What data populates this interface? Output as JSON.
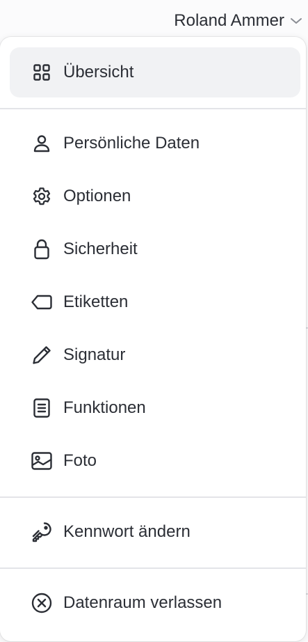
{
  "user": {
    "name": "Roland Ammer",
    "chevron_icon": "chevron-down-icon"
  },
  "menu": {
    "overview": {
      "label": "Übersicht",
      "icon": "grid-icon",
      "active": true
    },
    "items": [
      {
        "label": "Persönliche Daten",
        "icon": "user-icon"
      },
      {
        "label": "Optionen",
        "icon": "gear-icon"
      },
      {
        "label": "Sicherheit",
        "icon": "lock-icon"
      },
      {
        "label": "Etiketten",
        "icon": "tag-icon"
      },
      {
        "label": "Signatur",
        "icon": "pen-icon"
      },
      {
        "label": "Funktionen",
        "icon": "document-icon"
      },
      {
        "label": "Foto",
        "icon": "photo-icon"
      }
    ],
    "change_password": {
      "label": "Kennwort ändern",
      "icon": "key-icon"
    },
    "leave": {
      "label": "Datenraum verlassen",
      "icon": "close-circle-icon"
    }
  },
  "colors": {
    "text": "#2b2e35",
    "active_bg": "#f1f2f4",
    "divider": "#e3e4e8"
  }
}
